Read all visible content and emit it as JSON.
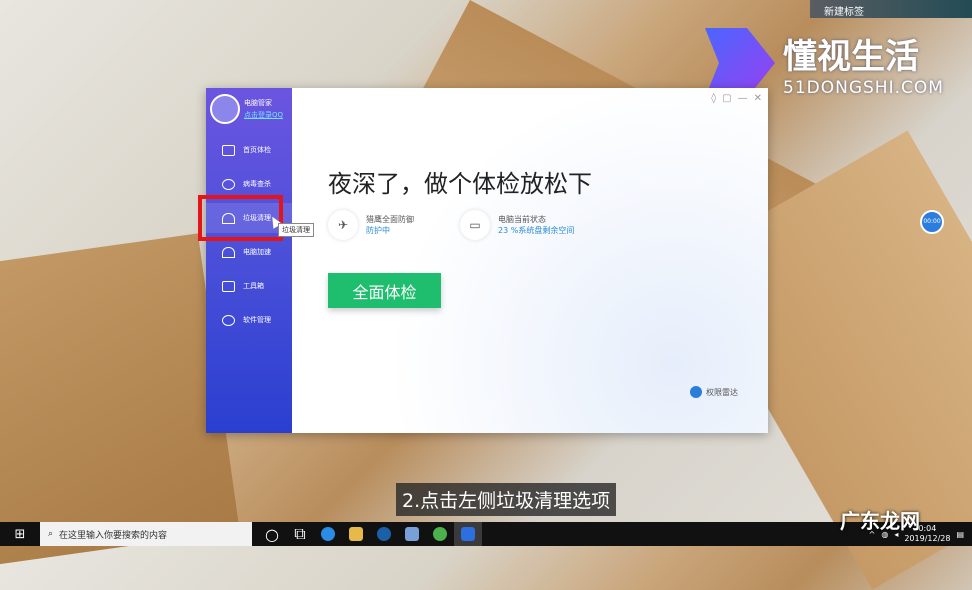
{
  "overlay": {
    "top_label": "新建标签",
    "logo_title": "懂视生活",
    "logo_sub": "51DONGSHI.COM",
    "watermark": "广东龙网",
    "circle_btn": "00:00",
    "subtitle": "2.点击左侧垃圾清理选项"
  },
  "app": {
    "user_name": "电脑管家",
    "user_login": "点击登录QQ",
    "nav": [
      {
        "label": "首页体检"
      },
      {
        "label": "病毒查杀"
      },
      {
        "label": "垃圾清理"
      },
      {
        "label": "电脑加速"
      },
      {
        "label": "工具箱"
      },
      {
        "label": "软件管理"
      }
    ],
    "tooltip": "垃圾清理",
    "headline": "夜深了，做个体检放松下",
    "stats": [
      {
        "title": "猎鹰全面防御",
        "value": "防护中"
      },
      {
        "title": "电脑当前状态",
        "value": "23 %系统盘剩余空间"
      }
    ],
    "cta": "全面体检",
    "radar": "权限雷达"
  },
  "taskbar": {
    "search_placeholder": "在这里输入你要搜索的内容",
    "time": "0:04",
    "date": "2019/12/28"
  }
}
